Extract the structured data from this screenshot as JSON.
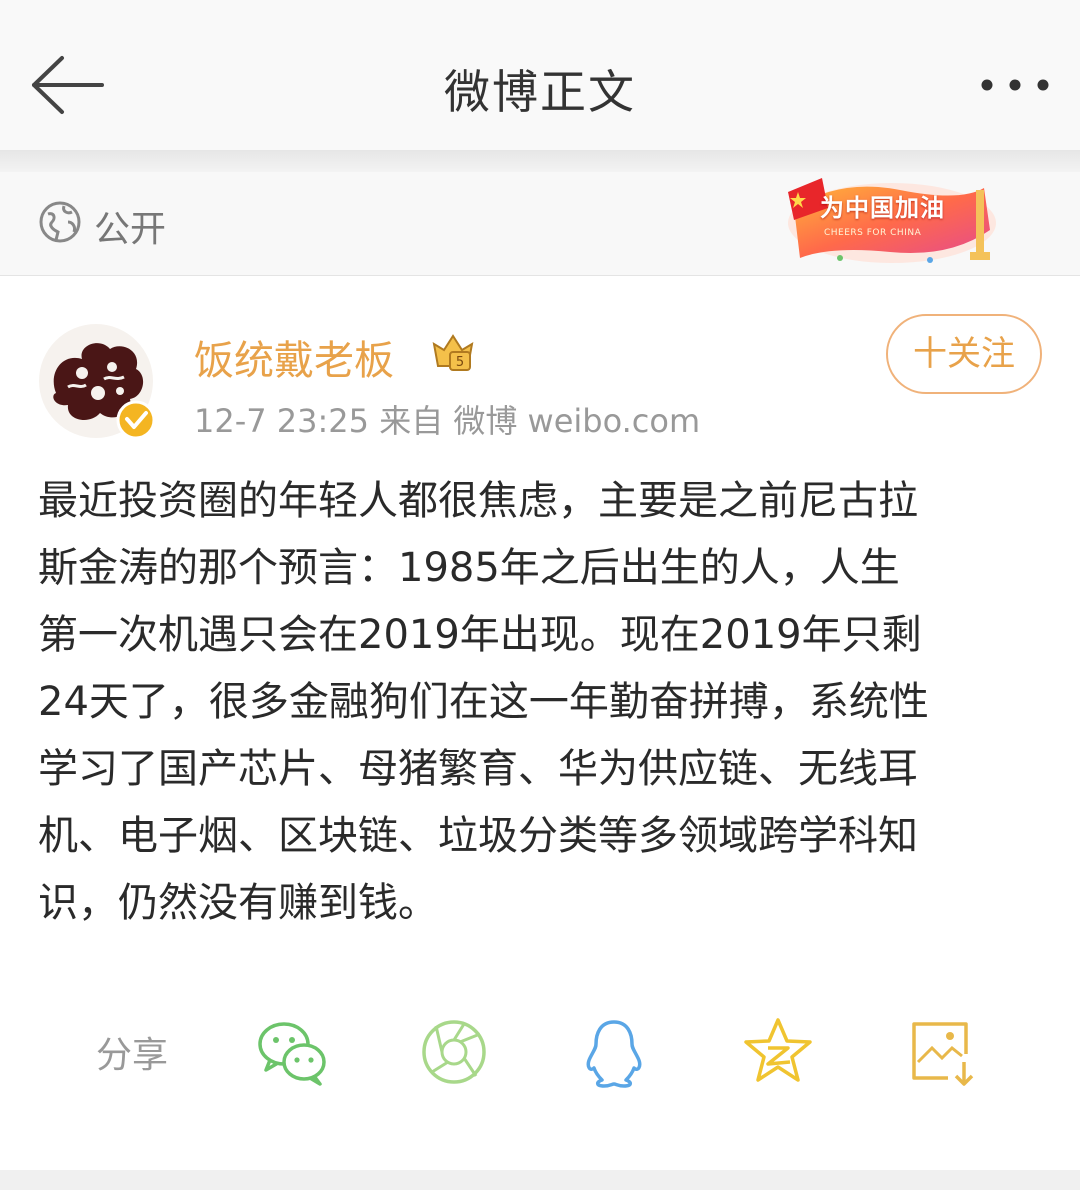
{
  "header": {
    "title": "微博正文",
    "back_icon": "arrow-left-icon",
    "more_icon": "more-dots-icon"
  },
  "visibility": {
    "label": "公开",
    "icon": "globe-icon"
  },
  "badge": {
    "title": "为中国加油",
    "subtitle": "CHEERS FOR CHINA"
  },
  "post": {
    "username": "饭统戴老板",
    "meta": "12-7 23:25   来自 微博 weibo.com",
    "follow_label": "十关注",
    "lines": [
      "最近投资圈的年轻人都很焦虑，主要是之前尼古拉",
      "斯金涛的那个预言：1985年之后出生的人，人生",
      "第一次机遇只会在2019年出现。现在2019年只剩",
      "24天了，很多金融狗们在这一年勤奋拼搏，系统性",
      "学习了国产芯片、母猪繁育、华为供应链、无线耳",
      "机、电子烟、区块链、垃圾分类等多领域跨学科知",
      "识，仍然没有赚到钱。"
    ]
  },
  "share": {
    "label": "分享",
    "icons": [
      "wechat-icon",
      "moments-icon",
      "qq-icon",
      "qzone-icon",
      "save-image-icon"
    ]
  },
  "colors": {
    "accent": "#e8a24a",
    "muted": "#999999",
    "share_green": "#6cc46a",
    "share_blue": "#5aa6e6",
    "share_yellow": "#f0c430"
  }
}
